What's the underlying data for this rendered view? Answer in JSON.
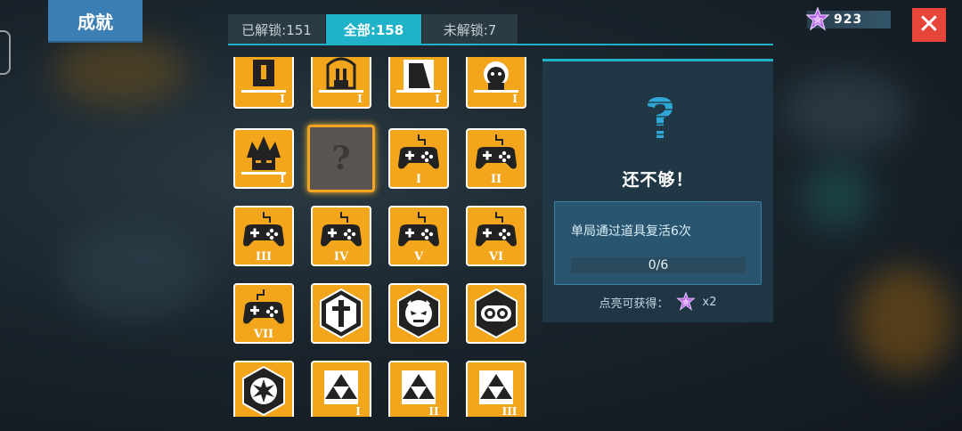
{
  "header": {
    "title": "成就",
    "tabs": [
      {
        "label": "已解锁:151",
        "active": false
      },
      {
        "label": "全部:158",
        "active": true
      },
      {
        "label": "未解锁:7",
        "active": false
      }
    ],
    "currency_value": "923",
    "close_label": "✕"
  },
  "grid": {
    "rows": [
      [
        {
          "icon": "banner-tower-icon",
          "rank": "I"
        },
        {
          "icon": "bunny-tower-icon",
          "rank": "I"
        },
        {
          "icon": "mask-tower-icon",
          "rank": "I"
        },
        {
          "icon": "fire-skull-icon",
          "rank": "I"
        }
      ],
      [
        {
          "icon": "spiky-hair-face-icon",
          "rank": "I"
        },
        {
          "icon": "locked-question-icon",
          "rank": "?"
        },
        {
          "icon": "gamepad-icon",
          "rank": "I"
        },
        {
          "icon": "gamepad-icon",
          "rank": "II"
        }
      ],
      [
        {
          "icon": "gamepad-icon",
          "rank": "III"
        },
        {
          "icon": "gamepad-icon",
          "rank": "IV"
        },
        {
          "icon": "gamepad-icon",
          "rank": "V"
        },
        {
          "icon": "gamepad-icon",
          "rank": "VI"
        }
      ],
      [
        {
          "icon": "gamepad-icon",
          "rank": "VII"
        },
        {
          "icon": "cross-emblem-icon",
          "rank": ""
        },
        {
          "icon": "demon-face-emblem-icon",
          "rank": ""
        },
        {
          "icon": "goggles-emblem-icon",
          "rank": ""
        }
      ],
      [
        {
          "icon": "burst-emblem-icon",
          "rank": ""
        },
        {
          "icon": "triangles-icon",
          "rank": "I"
        },
        {
          "icon": "triangles-icon",
          "rank": "II"
        },
        {
          "icon": "triangles-icon",
          "rank": "III"
        }
      ]
    ]
  },
  "detail": {
    "heading": "还不够！",
    "requirement": "单局通过道具复活6次",
    "progress": "0/6",
    "reward_label": "点亮可获得：",
    "reward_amount": "x2"
  },
  "colors": {
    "badge_orange": "#f3a51c",
    "accent_teal": "#1fb2c8",
    "close_red": "#e6453a",
    "title_blue": "#3c7fb4"
  }
}
